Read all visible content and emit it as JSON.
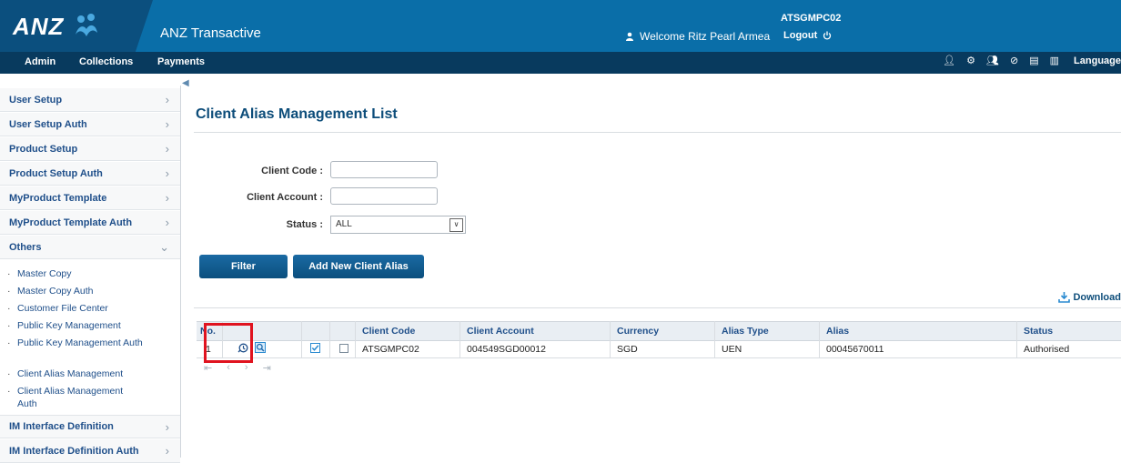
{
  "brand": {
    "logo_text": "ANZ",
    "app_title": "ANZ Transactive"
  },
  "header": {
    "user_id": "ATSGMPC02",
    "welcome": "Welcome Ritz Pearl Armea",
    "logout": "Logout"
  },
  "nav": {
    "items": [
      "Admin",
      "Collections",
      "Payments"
    ],
    "language": "Language"
  },
  "sidebar": {
    "items": [
      "User Setup",
      "User Setup Auth",
      "Product Setup",
      "Product Setup Auth",
      "MyProduct Template",
      "MyProduct Template Auth",
      "Others"
    ],
    "sub_items": [
      "Master Copy",
      "Master Copy Auth",
      "Customer File Center",
      "Public Key Management",
      "Public Key Management Auth",
      "Client Alias Management",
      "Client Alias Management Auth"
    ],
    "bottom_items": [
      "IM Interface Definition",
      "IM Interface Definition Auth"
    ]
  },
  "page": {
    "title": "Client Alias Management List"
  },
  "filters": {
    "client_code_label": "Client Code :",
    "client_account_label": "Client Account :",
    "status_label": "Status :",
    "status_value": "ALL",
    "client_code_value": "",
    "client_account_value": ""
  },
  "buttons": {
    "filter": "Filter",
    "add_new": "Add New Client Alias",
    "download": "Download"
  },
  "table": {
    "headers": [
      "No.",
      "Client Code",
      "Client Account",
      "Currency",
      "Alias Type",
      "Alias",
      "Status"
    ],
    "rows": [
      {
        "no": "1",
        "client_code": "ATSGMPC02",
        "client_account": "004549SGD00012",
        "currency": "SGD",
        "alias_type": "UEN",
        "alias": "00045670011",
        "status": "Authorised"
      }
    ]
  },
  "icons": {
    "history": "history-icon",
    "view": "magnifier-icon"
  },
  "colors": {
    "header_blue": "#0a6ea8",
    "nav_dark": "#083a5e",
    "highlight": "#e0131f"
  }
}
